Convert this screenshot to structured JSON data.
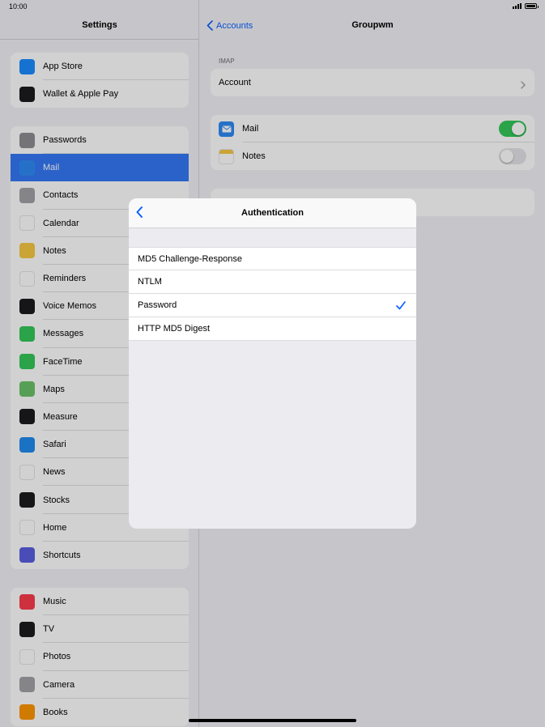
{
  "status": {
    "time": "10:00",
    "battery_level": 1.0
  },
  "sidebar": {
    "title": "Settings",
    "groups": [
      [
        {
          "label": "App Store",
          "icon": "app-store-icon",
          "color": "#1a8cff"
        },
        {
          "label": "Wallet & Apple Pay",
          "icon": "wallet-icon",
          "color": "#1c1c1e"
        }
      ],
      [
        {
          "label": "Passwords",
          "icon": "key-icon",
          "color": "#8e8e93"
        },
        {
          "label": "Mail",
          "icon": "mail-icon",
          "color": "#2f8af5",
          "selected": true
        },
        {
          "label": "Contacts",
          "icon": "contacts-icon",
          "color": "#a3a3a8"
        },
        {
          "label": "Calendar",
          "icon": "calendar-icon",
          "color": "#ffffff"
        },
        {
          "label": "Notes",
          "icon": "notes-icon",
          "color": "#f7c843"
        },
        {
          "label": "Reminders",
          "icon": "reminders-icon",
          "color": "#ffffff"
        },
        {
          "label": "Voice Memos",
          "icon": "voice-memos-icon",
          "color": "#1c1c1e"
        },
        {
          "label": "Messages",
          "icon": "messages-icon",
          "color": "#34c759"
        },
        {
          "label": "FaceTime",
          "icon": "facetime-icon",
          "color": "#34c759"
        },
        {
          "label": "Maps",
          "icon": "maps-icon",
          "color": "#6cc36a"
        },
        {
          "label": "Measure",
          "icon": "measure-icon",
          "color": "#1c1c1e"
        },
        {
          "label": "Safari",
          "icon": "safari-icon",
          "color": "#1f8cf0"
        },
        {
          "label": "News",
          "icon": "news-icon",
          "color": "#ffffff"
        },
        {
          "label": "Stocks",
          "icon": "stocks-icon",
          "color": "#1c1c1e"
        },
        {
          "label": "Home",
          "icon": "home-icon",
          "color": "#ffffff"
        },
        {
          "label": "Shortcuts",
          "icon": "shortcuts-icon",
          "color": "#5b5fe0"
        }
      ],
      [
        {
          "label": "Music",
          "icon": "music-icon",
          "color": "#fa3c4c"
        },
        {
          "label": "TV",
          "icon": "tv-icon",
          "color": "#1c1c1e"
        },
        {
          "label": "Photos",
          "icon": "photos-icon",
          "color": "#ffffff"
        },
        {
          "label": "Camera",
          "icon": "camera-icon",
          "color": "#a3a3a8"
        },
        {
          "label": "Books",
          "icon": "books-icon",
          "color": "#ff9500"
        }
      ]
    ]
  },
  "detail": {
    "back_label": "Accounts",
    "title": "Groupwm",
    "section_imap": "IMAP",
    "account_label": "Account",
    "mail_label": "Mail",
    "mail_on": true,
    "notes_label": "Notes",
    "notes_on": false
  },
  "modal": {
    "title": "Authentication",
    "options": [
      {
        "label": "MD5 Challenge-Response",
        "checked": false
      },
      {
        "label": "NTLM",
        "checked": false
      },
      {
        "label": "Password",
        "checked": true
      },
      {
        "label": "HTTP MD5 Digest",
        "checked": false
      }
    ]
  },
  "colors": {
    "accent": "#0a60ff",
    "toggle_on": "#34c759",
    "toggle_off": "#e5e5ea",
    "selected_row": "#3478f6"
  }
}
